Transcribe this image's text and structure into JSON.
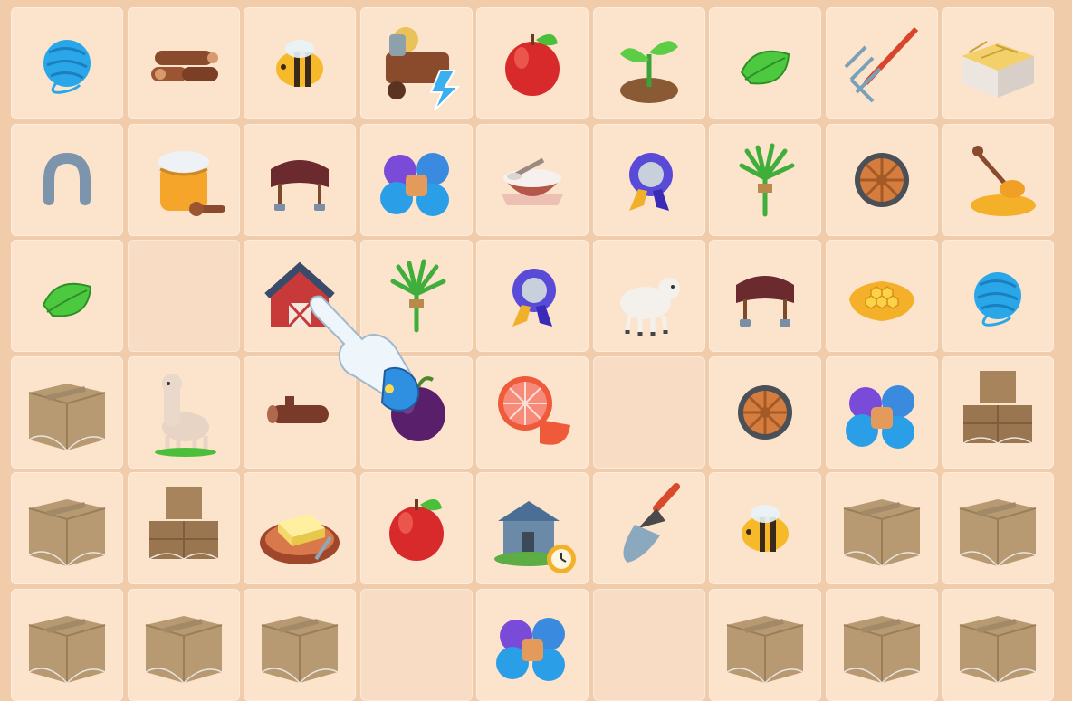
{
  "board": {
    "rows": [
      [
        "yarn-ball",
        "firewood",
        "bee",
        "wheelbarrow-generator",
        "apple",
        "sprout",
        "leaf",
        "pitchfork",
        "hay-crate"
      ],
      [
        "horseshoe",
        "honey-jar",
        "saddle",
        "yarn-pile",
        "milk-bowl",
        "ribbon-award",
        "grass-bundle",
        "wagon-wheel",
        "honey-dipper"
      ],
      [
        "leaf",
        "empty",
        "barn-generator",
        "grass-bundle",
        "ribbon-award",
        "lamb",
        "saddle",
        "honeycomb",
        "yarn-ball"
      ],
      [
        "cardboard-box",
        "alpaca",
        "log",
        "plum",
        "grapefruit",
        "empty",
        "wagon-wheel",
        "yarn-pile",
        "cardboard-box-stack"
      ],
      [
        "cardboard-box",
        "cardboard-box-stack",
        "butter-plate",
        "apple",
        "cottage-timer",
        "trowel",
        "bee",
        "cardboard-box",
        "cardboard-box"
      ],
      [
        "cardboard-box",
        "cardboard-box",
        "cardboard-box",
        "empty",
        "yarn-pile",
        "empty",
        "cardboard-box",
        "cardboard-box",
        "cardboard-box"
      ]
    ]
  },
  "tutorial_hand": "pointing-hand-icon",
  "colors": {
    "board_bg": "#f0ccaa",
    "cell_bg": "#fbe3cc",
    "energy": "#3ab0f0"
  }
}
